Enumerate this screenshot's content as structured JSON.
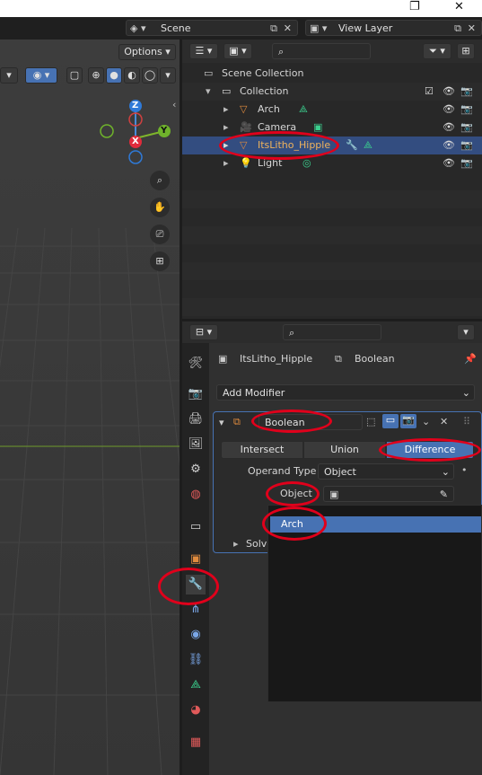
{
  "window": {
    "restore_glyph": "❐",
    "close_glyph": "✕"
  },
  "topbar": {
    "scene_label": "Scene",
    "view_layer_label": "View Layer"
  },
  "viewport": {
    "options_label": "Options",
    "gizmo": {
      "z": "Z",
      "y": "Y",
      "x": "X"
    }
  },
  "outliner": {
    "scene_collection": "Scene Collection",
    "collection": "Collection",
    "items": [
      {
        "label": "Arch"
      },
      {
        "label": "Camera"
      },
      {
        "label": "ItsLitho_Hipple"
      },
      {
        "label": "Light"
      }
    ]
  },
  "properties": {
    "breadcrumb_object": "ItsLitho_Hipple",
    "breadcrumb_modifier": "Boolean",
    "add_modifier": "Add Modifier",
    "modifier_name": "Boolean",
    "ops": [
      "Intersect",
      "Union",
      "Difference"
    ],
    "operand_type_label": "Operand Type",
    "operand_type_value": "Object",
    "object_label": "Object",
    "solver_label": "Solve",
    "dropdown_item": "Arch"
  },
  "colors": {
    "accent_blue": "#4772b3",
    "annotation_red": "#e0001b",
    "object_orange": "#e08b3e"
  }
}
